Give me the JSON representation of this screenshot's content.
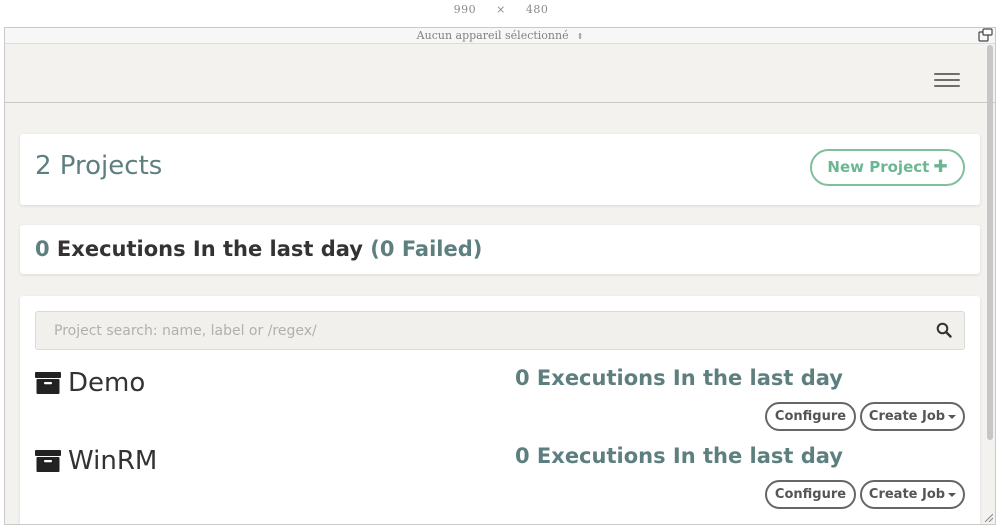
{
  "devtools": {
    "width": "990",
    "times": "×",
    "height": "480",
    "device_select": "Aucun appareil sélectionné",
    "select_arrow": "⇕",
    "rotate_icon": "rotate-icon"
  },
  "header": {
    "menu_icon": "hamburger-menu-icon"
  },
  "projects_card": {
    "title": "2 Projects",
    "new_project_label": "New Project",
    "plus": "✚"
  },
  "executions_summary": {
    "count": "0",
    "label": " Executions In the last day ",
    "failed": "(0 Failed)"
  },
  "search": {
    "placeholder": "Project search: name, label or /regex/"
  },
  "projects": [
    {
      "name": "Demo",
      "executions": "0 Executions In the last day",
      "configure_label": "Configure",
      "create_job_label": "Create Job"
    },
    {
      "name": "WinRM",
      "executions": "0 Executions In the last day",
      "configure_label": "Configure",
      "create_job_label": "Create Job"
    }
  ],
  "colors": {
    "accent_green": "#6bb794",
    "teal_text": "#5e7f7f",
    "page_bg": "#f3f2ef"
  }
}
